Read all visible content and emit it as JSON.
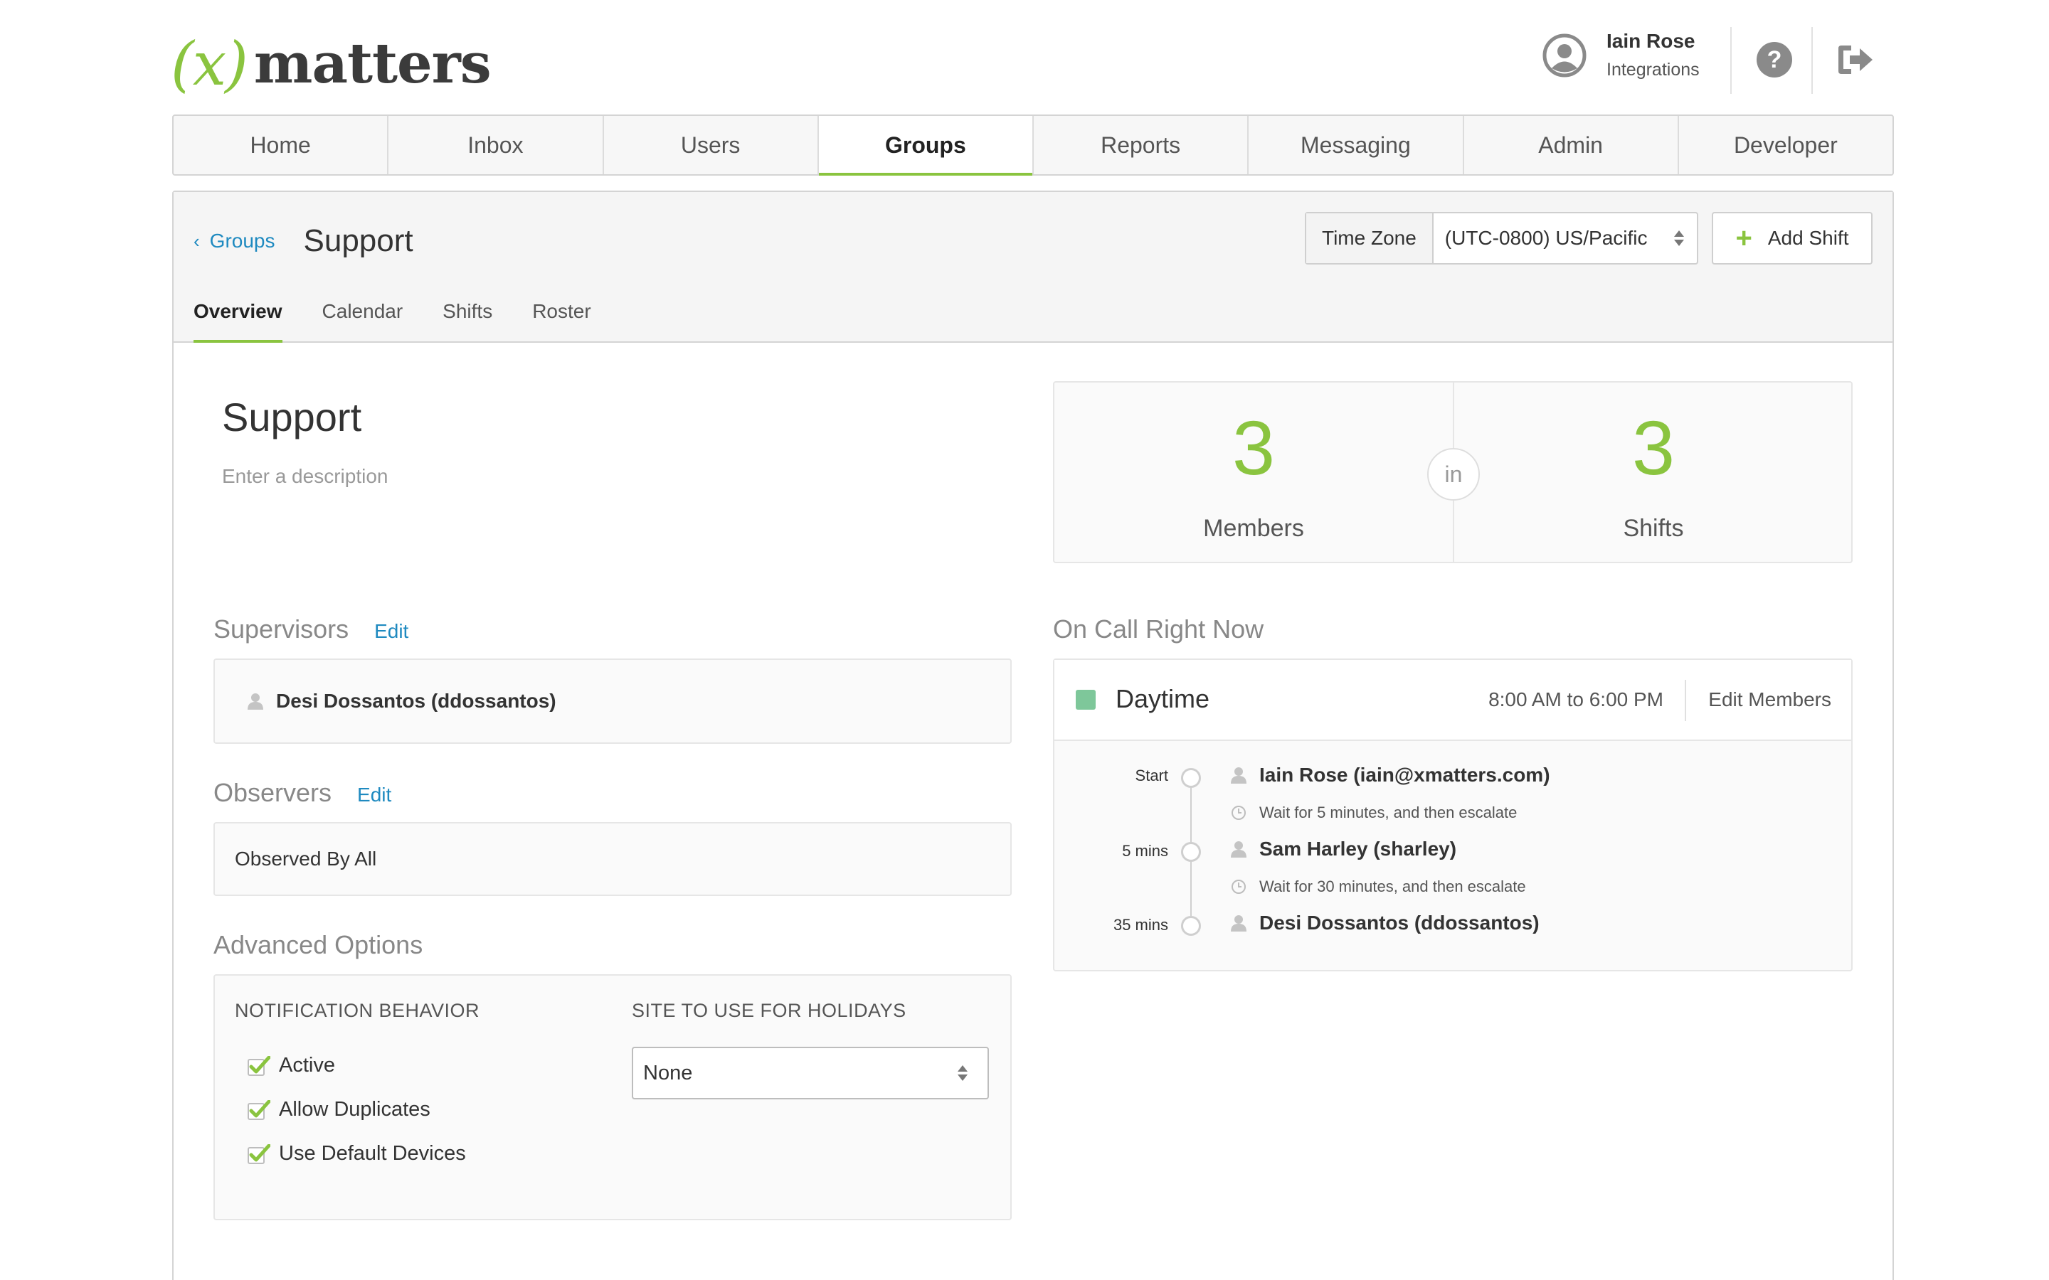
{
  "brand": {
    "logo_symbol": "(x)",
    "logo_word": "matters",
    "accent_color": "#8ac43f",
    "link_color": "#1f8ac0"
  },
  "header": {
    "user_name": "Iain Rose",
    "user_role": "Integrations",
    "avatar_icon": "user-avatar-icon",
    "help_icon": "help-icon",
    "logout_icon": "logout-icon"
  },
  "nav": {
    "items": [
      {
        "label": "Home"
      },
      {
        "label": "Inbox"
      },
      {
        "label": "Users"
      },
      {
        "label": "Groups",
        "active": true
      },
      {
        "label": "Reports"
      },
      {
        "label": "Messaging"
      },
      {
        "label": "Admin"
      },
      {
        "label": "Developer"
      }
    ]
  },
  "page": {
    "breadcrumb_back": "Groups",
    "title": "Support",
    "timezone_label": "Time Zone",
    "timezone_value": "(UTC-0800) US/Pacific",
    "add_shift_label": "Add Shift",
    "tabs": [
      {
        "label": "Overview",
        "active": true
      },
      {
        "label": "Calendar"
      },
      {
        "label": "Shifts"
      },
      {
        "label": "Roster"
      }
    ]
  },
  "group": {
    "name": "Support",
    "description_placeholder": "Enter a description"
  },
  "stats": {
    "members_count": "3",
    "members_label": "Members",
    "connector": "in",
    "shifts_count": "3",
    "shifts_label": "Shifts"
  },
  "supervisors": {
    "title": "Supervisors",
    "edit_label": "Edit",
    "items": [
      {
        "name": "Desi Dossantos (ddossantos)"
      }
    ]
  },
  "observers": {
    "title": "Observers",
    "edit_label": "Edit",
    "value": "Observed By All"
  },
  "advanced": {
    "title": "Advanced Options",
    "notification_heading": "NOTIFICATION BEHAVIOR",
    "holiday_heading": "SITE TO USE FOR HOLIDAYS",
    "options": [
      {
        "label": "Active",
        "checked": true
      },
      {
        "label": "Allow Duplicates",
        "checked": true
      },
      {
        "label": "Use Default Devices",
        "checked": true
      }
    ],
    "holiday_site": "None"
  },
  "oncall": {
    "title": "On Call Right Now",
    "shift_name": "Daytime",
    "shift_color": "#7ec79a",
    "shift_time": "8:00 AM to 6:00 PM",
    "edit_members_label": "Edit Members",
    "escalation": [
      {
        "offset": "Start",
        "name": "Iain Rose (iain@xmatters.com)",
        "wait": "Wait for 5 minutes, and then escalate"
      },
      {
        "offset": "5 mins",
        "name": "Sam Harley (sharley)",
        "wait": "Wait for 30 minutes, and then escalate"
      },
      {
        "offset": "35 mins",
        "name": "Desi Dossantos (ddossantos)"
      }
    ]
  }
}
